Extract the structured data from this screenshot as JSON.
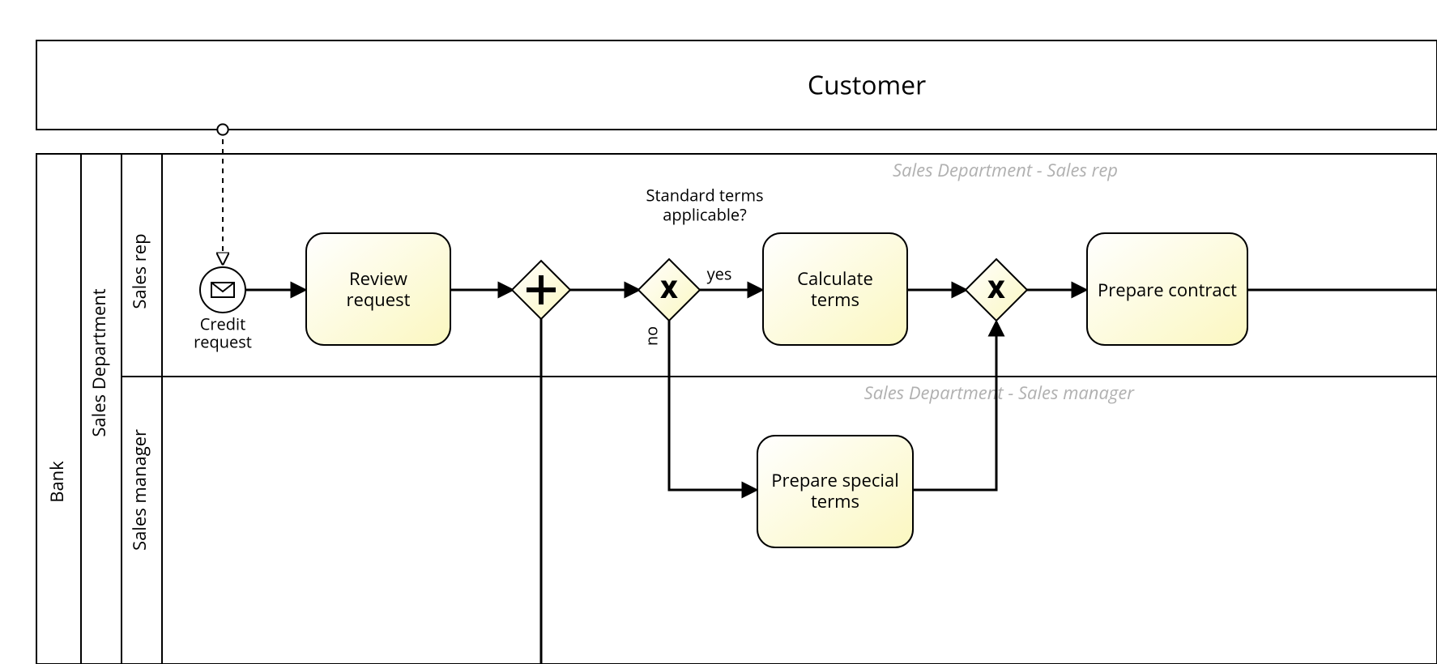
{
  "pools": {
    "customer": {
      "title": "Customer"
    },
    "bank": {
      "title": "Bank"
    }
  },
  "lanes": {
    "salesDept": {
      "title": "Sales Department"
    },
    "salesRep": {
      "title": "Sales rep",
      "watermark": "Sales Department - Sales rep"
    },
    "salesManager": {
      "title": "Sales manager",
      "watermark": "Sales Department - Sales manager"
    }
  },
  "events": {
    "creditRequest": {
      "label": "Credit\nrequest"
    }
  },
  "tasks": {
    "reviewRequest": {
      "label": "Review\nrequest"
    },
    "calculateTerms": {
      "label": "Calculate\nterms"
    },
    "prepareContract": {
      "label": "Prepare contract"
    },
    "prepareSpecialTerms": {
      "label": "Prepare special\nterms"
    }
  },
  "gateways": {
    "parallel1": {
      "marker": "+"
    },
    "exclusiveDecision": {
      "label": "Standard terms\napplicable?",
      "yes": "yes",
      "no": "no"
    },
    "exclusiveMerge": {}
  }
}
